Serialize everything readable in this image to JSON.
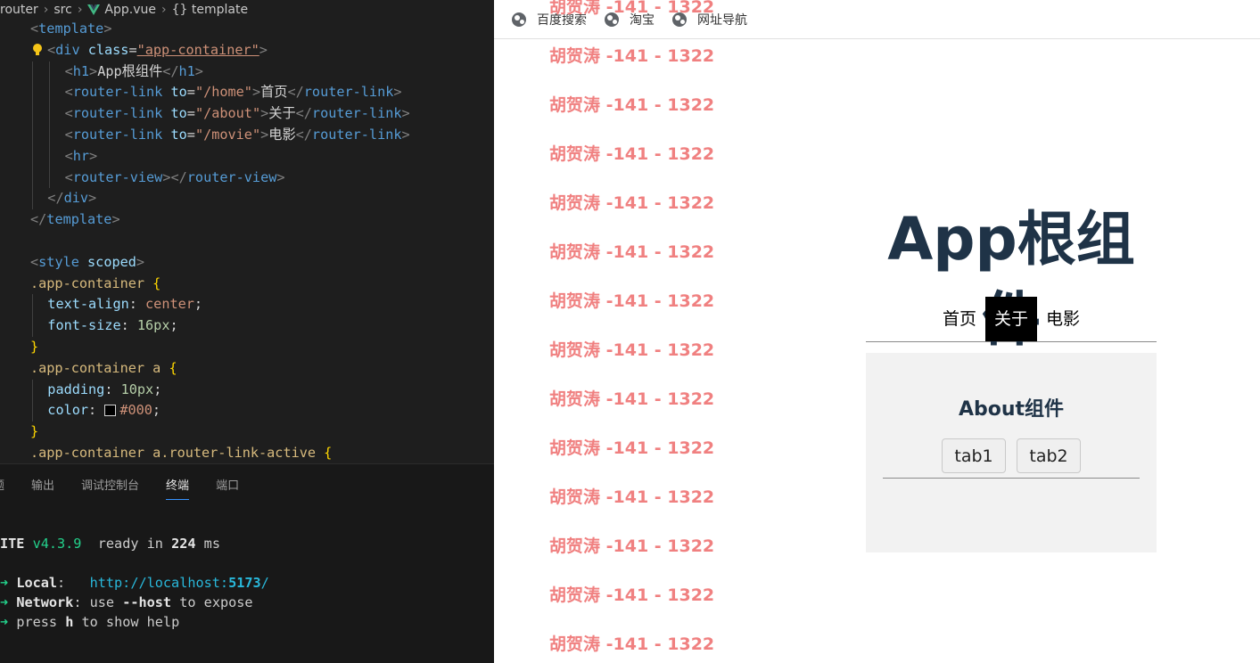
{
  "editor": {
    "breadcrumb": [
      "router",
      "src",
      "App.vue",
      "{} template"
    ],
    "code_lines": [
      {
        "n": "",
        "html": [
          [
            "t-tag",
            "<"
          ],
          [
            "t-name",
            "template"
          ],
          [
            "t-tag",
            ">"
          ]
        ]
      },
      {
        "n": "",
        "bulb": true,
        "html": [
          [
            "t-tag",
            "<"
          ],
          [
            "t-name",
            "div "
          ],
          [
            "t-attr",
            "class"
          ],
          [
            "t-text",
            "="
          ],
          [
            "t-str",
            "\"app-container\""
          ],
          [
            "t-tag",
            ">"
          ]
        ]
      },
      {
        "n": "",
        "indent": 2,
        "html": [
          [
            "t-tag",
            "<"
          ],
          [
            "t-name",
            "h1"
          ],
          [
            "t-tag",
            ">"
          ],
          [
            "t-text",
            "App根组件"
          ],
          [
            "t-tag",
            "</"
          ],
          [
            "t-name",
            "h1"
          ],
          [
            "t-tag",
            ">"
          ]
        ]
      },
      {
        "n": "",
        "indent": 2,
        "html": [
          [
            "t-tag",
            "<"
          ],
          [
            "t-name",
            "router-link "
          ],
          [
            "t-attr",
            "to"
          ],
          [
            "t-text",
            "="
          ],
          [
            "t-str",
            "\"/home\""
          ],
          [
            "t-tag",
            ">"
          ],
          [
            "t-text",
            "首页"
          ],
          [
            "t-tag",
            "</"
          ],
          [
            "t-name",
            "router-link"
          ],
          [
            "t-tag",
            ">"
          ]
        ]
      },
      {
        "n": "",
        "indent": 2,
        "html": [
          [
            "t-tag",
            "<"
          ],
          [
            "t-name",
            "router-link "
          ],
          [
            "t-attr",
            "to"
          ],
          [
            "t-text",
            "="
          ],
          [
            "t-str",
            "\"/about\""
          ],
          [
            "t-tag",
            ">"
          ],
          [
            "t-text",
            "关于"
          ],
          [
            "t-tag",
            "</"
          ],
          [
            "t-name",
            "router-link"
          ],
          [
            "t-tag",
            ">"
          ]
        ]
      },
      {
        "n": "",
        "indent": 2,
        "html": [
          [
            "t-tag",
            "<"
          ],
          [
            "t-name",
            "router-link "
          ],
          [
            "t-attr",
            "to"
          ],
          [
            "t-text",
            "="
          ],
          [
            "t-str",
            "\"/movie\""
          ],
          [
            "t-tag",
            ">"
          ],
          [
            "t-text",
            "电影"
          ],
          [
            "t-tag",
            "</"
          ],
          [
            "t-name",
            "router-link"
          ],
          [
            "t-tag",
            ">"
          ]
        ]
      },
      {
        "n": "",
        "indent": 2,
        "html": [
          [
            "t-tag",
            "<"
          ],
          [
            "t-name",
            "hr"
          ],
          [
            "t-tag",
            ">"
          ]
        ]
      },
      {
        "n": "",
        "indent": 2,
        "html": [
          [
            "t-tag",
            "<"
          ],
          [
            "t-name",
            "router-view"
          ],
          [
            "t-tag",
            "></"
          ],
          [
            "t-name",
            "router-view"
          ],
          [
            "t-tag",
            ">"
          ]
        ]
      },
      {
        "n": "",
        "indent": 1,
        "html": [
          [
            "t-tag",
            "</"
          ],
          [
            "t-name",
            "div"
          ],
          [
            "t-tag",
            ">"
          ]
        ]
      },
      {
        "n": "",
        "html": [
          [
            "t-tag",
            "</"
          ],
          [
            "t-name",
            "template"
          ],
          [
            "t-tag",
            ">"
          ]
        ]
      },
      {
        "n": "",
        "html": []
      },
      {
        "n": "",
        "html": [
          [
            "t-tag",
            "<"
          ],
          [
            "t-name",
            "style "
          ],
          [
            "t-attr",
            "scoped"
          ],
          [
            "t-tag",
            ">"
          ]
        ]
      },
      {
        "n": "",
        "html": [
          [
            "t-sel",
            ".app-container "
          ],
          [
            "t-brace",
            "{"
          ]
        ]
      },
      {
        "n": "",
        "indent": 1,
        "html": [
          [
            "t-prop",
            "text-align"
          ],
          [
            "t-text",
            ": "
          ],
          [
            "t-val",
            "center"
          ],
          [
            "t-text",
            ";"
          ]
        ]
      },
      {
        "n": "",
        "indent": 1,
        "html": [
          [
            "t-prop",
            "font-size"
          ],
          [
            "t-text",
            ": "
          ],
          [
            "t-num",
            "16px"
          ],
          [
            "t-text",
            ";"
          ]
        ]
      },
      {
        "n": "",
        "html": [
          [
            "t-brace",
            "}"
          ]
        ]
      },
      {
        "n": "",
        "html": [
          [
            "t-sel",
            ".app-container a "
          ],
          [
            "t-brace",
            "{"
          ]
        ]
      },
      {
        "n": "",
        "indent": 1,
        "html": [
          [
            "t-prop",
            "padding"
          ],
          [
            "t-text",
            ": "
          ],
          [
            "t-num",
            "10px"
          ],
          [
            "t-text",
            ";"
          ]
        ]
      },
      {
        "n": "",
        "indent": 1,
        "swatch": true,
        "html": [
          [
            "t-prop",
            "color"
          ],
          [
            "t-text",
            ": "
          ],
          [
            "t-val",
            "#000"
          ],
          [
            "t-text",
            ";"
          ]
        ]
      },
      {
        "n": "",
        "html": [
          [
            "t-brace",
            "}"
          ]
        ]
      },
      {
        "n": "",
        "html": [
          [
            "t-sel",
            ".app-container a.router-link-active "
          ],
          [
            "t-brace",
            "{"
          ]
        ]
      }
    ]
  },
  "panel": {
    "tabs": [
      "题",
      "输出",
      "调试控制台",
      "终端",
      "端口"
    ],
    "active_tab": "终端",
    "terminal": {
      "vite": "ITE",
      "version": "v4.3.9",
      "ready_text": "ready in",
      "ready_ms": "224",
      "ms": "ms",
      "local_label": "Local",
      "local_url_pre": "http://localhost:",
      "local_port": "5173",
      "local_url_post": "/",
      "network_label": "Network",
      "network_text_pre": "use",
      "network_flag": "--host",
      "network_text_post": "to expose",
      "help_pre": "press",
      "help_key": "h",
      "help_post": "to show help",
      "arrow": "➜"
    }
  },
  "browser": {
    "bookmarks": [
      "百度搜索",
      "淘宝",
      "网址导航"
    ],
    "watermark_text": "胡贺涛 -141 - 1322",
    "app_title": "App根组件",
    "nav": [
      "首页",
      "关于",
      "电影"
    ],
    "active_nav": "关于",
    "about_title": "About组件",
    "tab_buttons": [
      "tab1",
      "tab2"
    ]
  }
}
